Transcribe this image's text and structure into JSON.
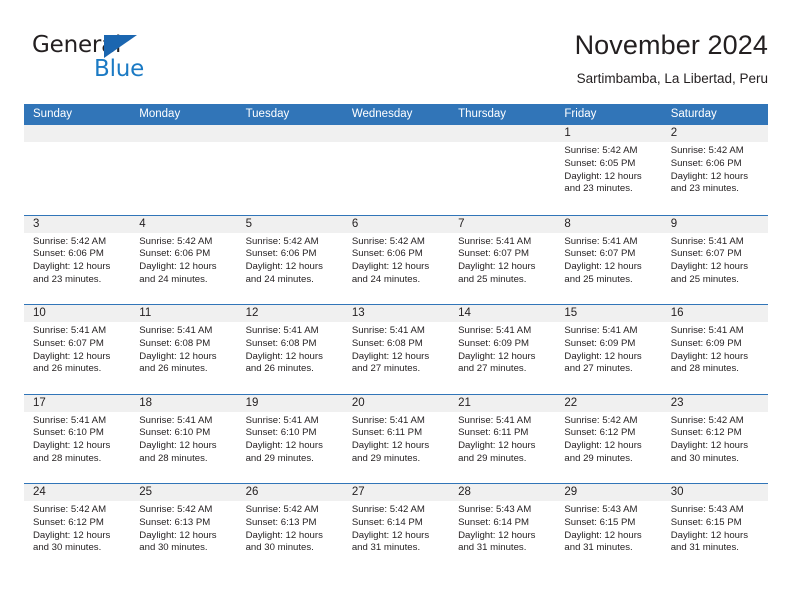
{
  "brand": {
    "name_part1": "General",
    "name_part2": "Blue",
    "triangle_color": "#1b66b0",
    "blue_text_color": "#1b7ac4"
  },
  "header": {
    "title": "November 2024",
    "subtitle": "Sartimbamba, La Libertad, Peru"
  },
  "colors": {
    "header_blue": "#3175b8",
    "day_band_gray": "#f0f0f0",
    "text": "#231f20"
  },
  "weekday_headers": [
    "Sunday",
    "Monday",
    "Tuesday",
    "Wednesday",
    "Thursday",
    "Friday",
    "Saturday"
  ],
  "labels": {
    "sunrise_prefix": "Sunrise:",
    "sunset_prefix": "Sunset:",
    "daylight_prefix": "Daylight:"
  },
  "weeks": [
    [
      {
        "day": "",
        "sunrise": "",
        "sunset": "",
        "daylight_line1": "",
        "daylight_line2": "",
        "empty": true
      },
      {
        "day": "",
        "sunrise": "",
        "sunset": "",
        "daylight_line1": "",
        "daylight_line2": "",
        "empty": true
      },
      {
        "day": "",
        "sunrise": "",
        "sunset": "",
        "daylight_line1": "",
        "daylight_line2": "",
        "empty": true
      },
      {
        "day": "",
        "sunrise": "",
        "sunset": "",
        "daylight_line1": "",
        "daylight_line2": "",
        "empty": true
      },
      {
        "day": "",
        "sunrise": "",
        "sunset": "",
        "daylight_line1": "",
        "daylight_line2": "",
        "empty": true
      },
      {
        "day": "1",
        "sunrise": "Sunrise: 5:42 AM",
        "sunset": "Sunset: 6:05 PM",
        "daylight_line1": "Daylight: 12 hours",
        "daylight_line2": "and 23 minutes.",
        "empty": false
      },
      {
        "day": "2",
        "sunrise": "Sunrise: 5:42 AM",
        "sunset": "Sunset: 6:06 PM",
        "daylight_line1": "Daylight: 12 hours",
        "daylight_line2": "and 23 minutes.",
        "empty": false
      }
    ],
    [
      {
        "day": "3",
        "sunrise": "Sunrise: 5:42 AM",
        "sunset": "Sunset: 6:06 PM",
        "daylight_line1": "Daylight: 12 hours",
        "daylight_line2": "and 23 minutes.",
        "empty": false
      },
      {
        "day": "4",
        "sunrise": "Sunrise: 5:42 AM",
        "sunset": "Sunset: 6:06 PM",
        "daylight_line1": "Daylight: 12 hours",
        "daylight_line2": "and 24 minutes.",
        "empty": false
      },
      {
        "day": "5",
        "sunrise": "Sunrise: 5:42 AM",
        "sunset": "Sunset: 6:06 PM",
        "daylight_line1": "Daylight: 12 hours",
        "daylight_line2": "and 24 minutes.",
        "empty": false
      },
      {
        "day": "6",
        "sunrise": "Sunrise: 5:42 AM",
        "sunset": "Sunset: 6:06 PM",
        "daylight_line1": "Daylight: 12 hours",
        "daylight_line2": "and 24 minutes.",
        "empty": false
      },
      {
        "day": "7",
        "sunrise": "Sunrise: 5:41 AM",
        "sunset": "Sunset: 6:07 PM",
        "daylight_line1": "Daylight: 12 hours",
        "daylight_line2": "and 25 minutes.",
        "empty": false
      },
      {
        "day": "8",
        "sunrise": "Sunrise: 5:41 AM",
        "sunset": "Sunset: 6:07 PM",
        "daylight_line1": "Daylight: 12 hours",
        "daylight_line2": "and 25 minutes.",
        "empty": false
      },
      {
        "day": "9",
        "sunrise": "Sunrise: 5:41 AM",
        "sunset": "Sunset: 6:07 PM",
        "daylight_line1": "Daylight: 12 hours",
        "daylight_line2": "and 25 minutes.",
        "empty": false
      }
    ],
    [
      {
        "day": "10",
        "sunrise": "Sunrise: 5:41 AM",
        "sunset": "Sunset: 6:07 PM",
        "daylight_line1": "Daylight: 12 hours",
        "daylight_line2": "and 26 minutes.",
        "empty": false
      },
      {
        "day": "11",
        "sunrise": "Sunrise: 5:41 AM",
        "sunset": "Sunset: 6:08 PM",
        "daylight_line1": "Daylight: 12 hours",
        "daylight_line2": "and 26 minutes.",
        "empty": false
      },
      {
        "day": "12",
        "sunrise": "Sunrise: 5:41 AM",
        "sunset": "Sunset: 6:08 PM",
        "daylight_line1": "Daylight: 12 hours",
        "daylight_line2": "and 26 minutes.",
        "empty": false
      },
      {
        "day": "13",
        "sunrise": "Sunrise: 5:41 AM",
        "sunset": "Sunset: 6:08 PM",
        "daylight_line1": "Daylight: 12 hours",
        "daylight_line2": "and 27 minutes.",
        "empty": false
      },
      {
        "day": "14",
        "sunrise": "Sunrise: 5:41 AM",
        "sunset": "Sunset: 6:09 PM",
        "daylight_line1": "Daylight: 12 hours",
        "daylight_line2": "and 27 minutes.",
        "empty": false
      },
      {
        "day": "15",
        "sunrise": "Sunrise: 5:41 AM",
        "sunset": "Sunset: 6:09 PM",
        "daylight_line1": "Daylight: 12 hours",
        "daylight_line2": "and 27 minutes.",
        "empty": false
      },
      {
        "day": "16",
        "sunrise": "Sunrise: 5:41 AM",
        "sunset": "Sunset: 6:09 PM",
        "daylight_line1": "Daylight: 12 hours",
        "daylight_line2": "and 28 minutes.",
        "empty": false
      }
    ],
    [
      {
        "day": "17",
        "sunrise": "Sunrise: 5:41 AM",
        "sunset": "Sunset: 6:10 PM",
        "daylight_line1": "Daylight: 12 hours",
        "daylight_line2": "and 28 minutes.",
        "empty": false
      },
      {
        "day": "18",
        "sunrise": "Sunrise: 5:41 AM",
        "sunset": "Sunset: 6:10 PM",
        "daylight_line1": "Daylight: 12 hours",
        "daylight_line2": "and 28 minutes.",
        "empty": false
      },
      {
        "day": "19",
        "sunrise": "Sunrise: 5:41 AM",
        "sunset": "Sunset: 6:10 PM",
        "daylight_line1": "Daylight: 12 hours",
        "daylight_line2": "and 29 minutes.",
        "empty": false
      },
      {
        "day": "20",
        "sunrise": "Sunrise: 5:41 AM",
        "sunset": "Sunset: 6:11 PM",
        "daylight_line1": "Daylight: 12 hours",
        "daylight_line2": "and 29 minutes.",
        "empty": false
      },
      {
        "day": "21",
        "sunrise": "Sunrise: 5:41 AM",
        "sunset": "Sunset: 6:11 PM",
        "daylight_line1": "Daylight: 12 hours",
        "daylight_line2": "and 29 minutes.",
        "empty": false
      },
      {
        "day": "22",
        "sunrise": "Sunrise: 5:42 AM",
        "sunset": "Sunset: 6:12 PM",
        "daylight_line1": "Daylight: 12 hours",
        "daylight_line2": "and 29 minutes.",
        "empty": false
      },
      {
        "day": "23",
        "sunrise": "Sunrise: 5:42 AM",
        "sunset": "Sunset: 6:12 PM",
        "daylight_line1": "Daylight: 12 hours",
        "daylight_line2": "and 30 minutes.",
        "empty": false
      }
    ],
    [
      {
        "day": "24",
        "sunrise": "Sunrise: 5:42 AM",
        "sunset": "Sunset: 6:12 PM",
        "daylight_line1": "Daylight: 12 hours",
        "daylight_line2": "and 30 minutes.",
        "empty": false
      },
      {
        "day": "25",
        "sunrise": "Sunrise: 5:42 AM",
        "sunset": "Sunset: 6:13 PM",
        "daylight_line1": "Daylight: 12 hours",
        "daylight_line2": "and 30 minutes.",
        "empty": false
      },
      {
        "day": "26",
        "sunrise": "Sunrise: 5:42 AM",
        "sunset": "Sunset: 6:13 PM",
        "daylight_line1": "Daylight: 12 hours",
        "daylight_line2": "and 30 minutes.",
        "empty": false
      },
      {
        "day": "27",
        "sunrise": "Sunrise: 5:42 AM",
        "sunset": "Sunset: 6:14 PM",
        "daylight_line1": "Daylight: 12 hours",
        "daylight_line2": "and 31 minutes.",
        "empty": false
      },
      {
        "day": "28",
        "sunrise": "Sunrise: 5:43 AM",
        "sunset": "Sunset: 6:14 PM",
        "daylight_line1": "Daylight: 12 hours",
        "daylight_line2": "and 31 minutes.",
        "empty": false
      },
      {
        "day": "29",
        "sunrise": "Sunrise: 5:43 AM",
        "sunset": "Sunset: 6:15 PM",
        "daylight_line1": "Daylight: 12 hours",
        "daylight_line2": "and 31 minutes.",
        "empty": false
      },
      {
        "day": "30",
        "sunrise": "Sunrise: 5:43 AM",
        "sunset": "Sunset: 6:15 PM",
        "daylight_line1": "Daylight: 12 hours",
        "daylight_line2": "and 31 minutes.",
        "empty": false
      }
    ]
  ]
}
